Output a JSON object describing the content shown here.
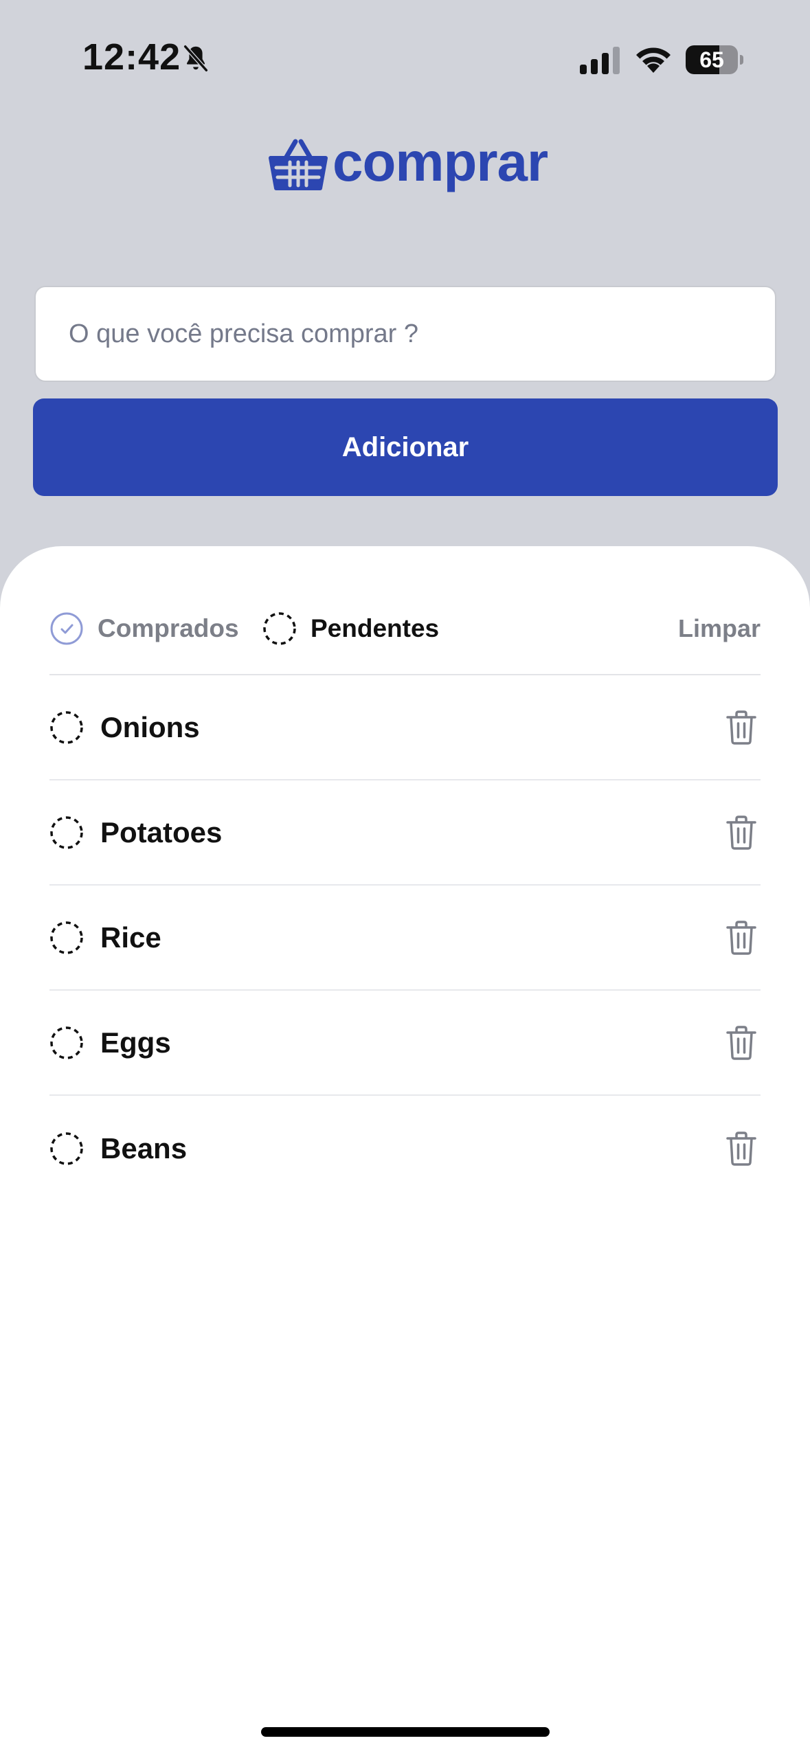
{
  "status_bar": {
    "time": "12:42",
    "battery": "65",
    "battery_level": 0.65,
    "icons": [
      "bell-slash-icon",
      "signal-icon",
      "wifi-icon",
      "battery-icon"
    ]
  },
  "logo": {
    "text": "comprar",
    "icon": "basket-icon"
  },
  "colors": {
    "accent": "#2c46b1",
    "background": "#d1d3da",
    "sheet": "#ffffff",
    "muted": "#7c7f88"
  },
  "form": {
    "input_placeholder": "O que você precisa comprar ?",
    "input_value": "",
    "add_label": "Adicionar"
  },
  "filters": {
    "purchased_label": "Comprados",
    "pending_label": "Pendentes",
    "clear_label": "Limpar",
    "active": "Pendentes"
  },
  "items": [
    {
      "name": "Onions",
      "status": "pending"
    },
    {
      "name": "Potatoes",
      "status": "pending"
    },
    {
      "name": "Rice",
      "status": "pending"
    },
    {
      "name": "Eggs",
      "status": "pending"
    },
    {
      "name": "Beans",
      "status": "pending"
    }
  ]
}
